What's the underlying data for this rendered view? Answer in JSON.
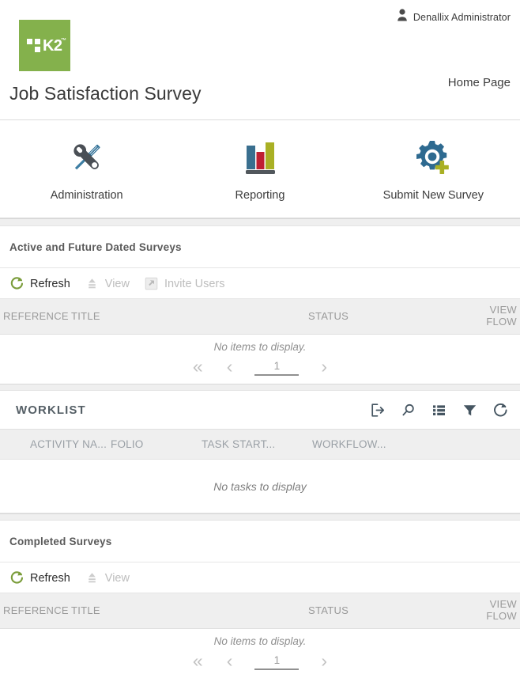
{
  "header": {
    "user_name": "Denallix Administrator",
    "user_icon": "person-icon",
    "logo_text": "K2",
    "logo_trademark": "™",
    "page_title": "Job Satisfaction Survey",
    "home_link": "Home Page",
    "logo_color": "#84b14c"
  },
  "shortcuts": [
    {
      "label": "Administration",
      "icon": "tools-icon"
    },
    {
      "label": "Reporting",
      "icon": "bar-chart-icon"
    },
    {
      "label": "Submit New Survey",
      "icon": "gear-plus-icon"
    }
  ],
  "active_surveys": {
    "title": "Active and Future Dated Surveys",
    "toolbar": [
      {
        "label": "Refresh",
        "icon": "refresh-icon",
        "enabled": true
      },
      {
        "label": "View",
        "icon": "view-icon",
        "enabled": false
      },
      {
        "label": "Invite Users",
        "icon": "invite-users-icon",
        "enabled": false
      }
    ],
    "columns": [
      "REFERENCE",
      "TITLE",
      "STATUS",
      "VIEW FLOW"
    ],
    "rows": [],
    "empty_text": "No items to display.",
    "pager": {
      "first_label": "«",
      "prev_label": "‹",
      "next_label": "›",
      "page_value": "1"
    }
  },
  "worklist": {
    "title": "WORKLIST",
    "icons": [
      {
        "name": "open-item-icon"
      },
      {
        "name": "search-icon"
      },
      {
        "name": "list-view-icon"
      },
      {
        "name": "filter-icon"
      },
      {
        "name": "refresh-icon"
      }
    ],
    "columns": [
      "ACTIVITY NA...",
      "FOLIO",
      "TASK START...",
      "WORKFLOW..."
    ],
    "rows": [],
    "empty_text": "No tasks to display"
  },
  "completed_surveys": {
    "title": "Completed Surveys",
    "toolbar": [
      {
        "label": "Refresh",
        "icon": "refresh-icon",
        "enabled": true
      },
      {
        "label": "View",
        "icon": "view-icon",
        "enabled": false
      }
    ],
    "columns": [
      "REFERENCE",
      "TITLE",
      "STATUS",
      "VIEW FLOW"
    ],
    "rows": [],
    "empty_text": "No items to display.",
    "pager": {
      "first_label": "«",
      "prev_label": "‹",
      "next_label": "›",
      "page_value": "1"
    }
  }
}
